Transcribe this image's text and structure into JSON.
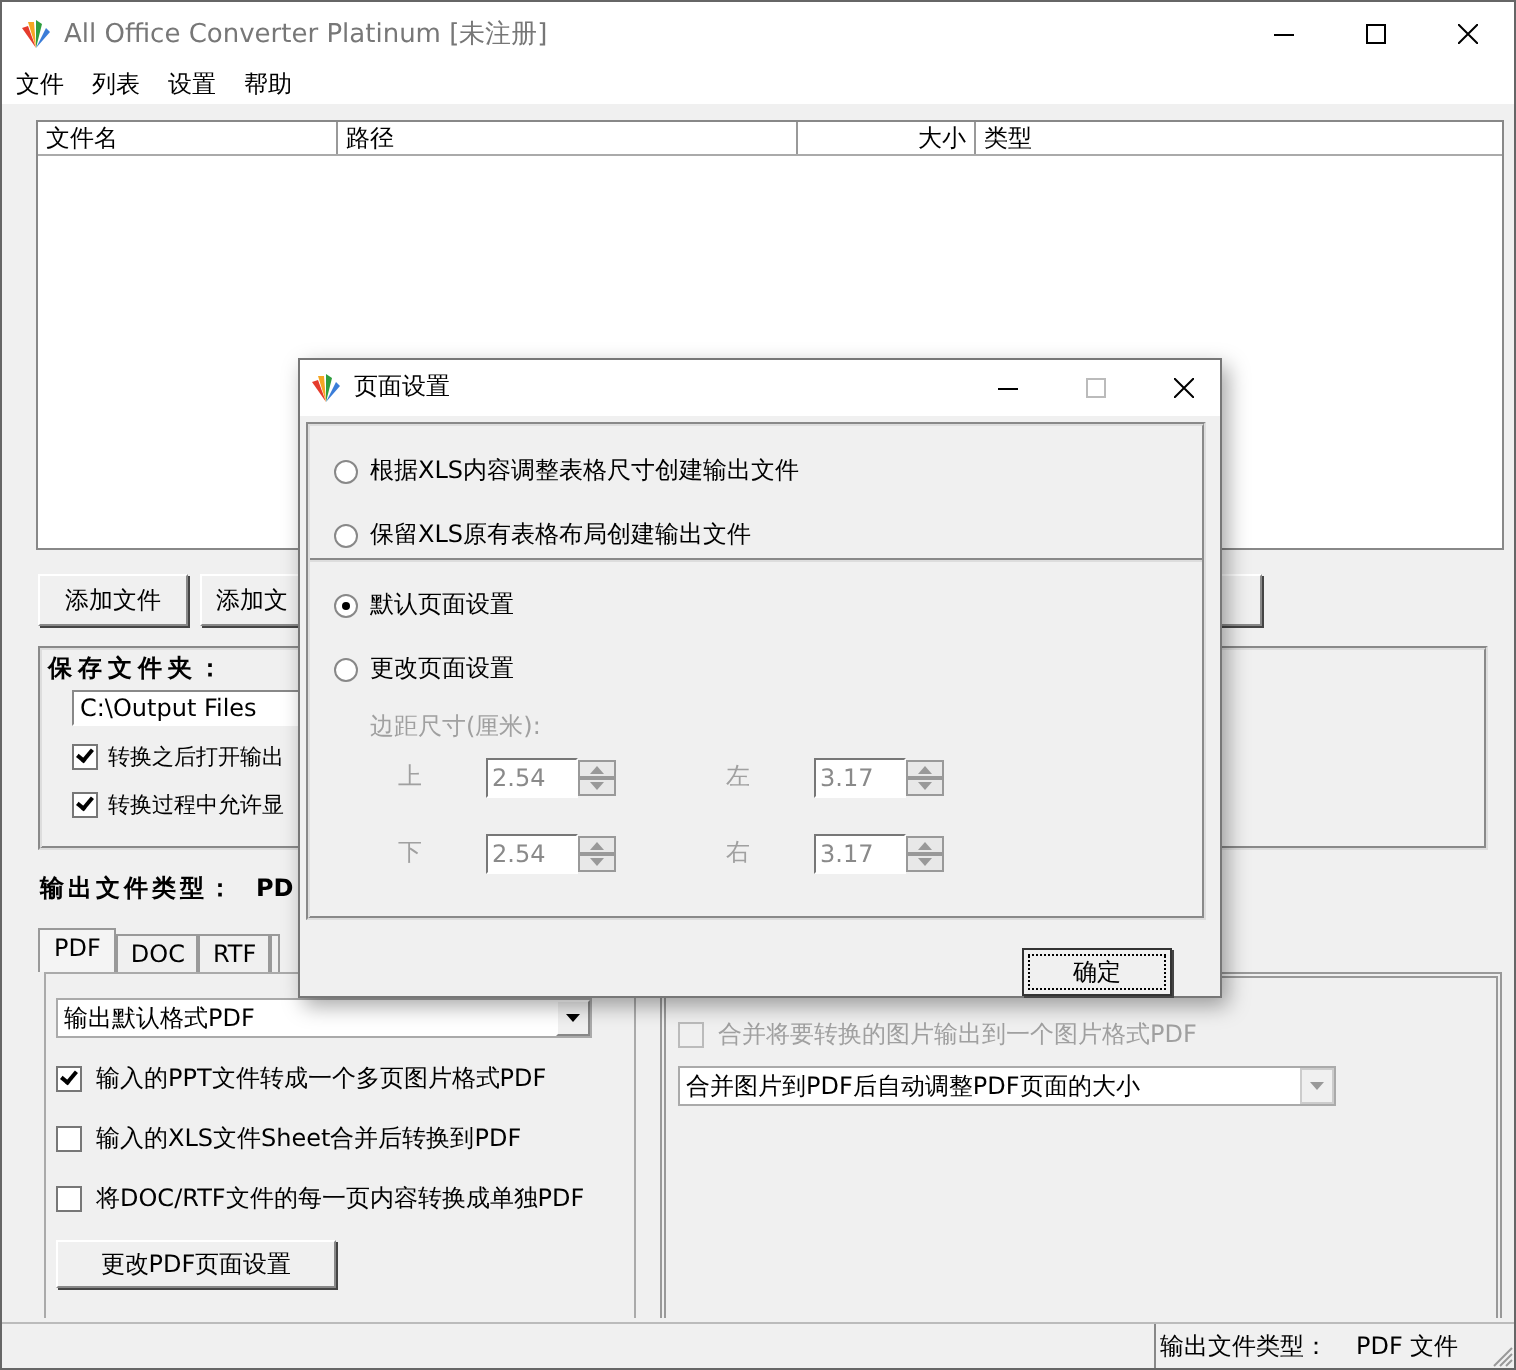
{
  "window": {
    "title": "All Office Converter Platinum [未注册]"
  },
  "menu": [
    "文件",
    "列表",
    "设置",
    "帮助"
  ],
  "file_list": {
    "columns": [
      "文件名",
      "路径",
      "大小",
      "类型"
    ]
  },
  "buttons": [
    "添加文件",
    "添加文"
  ],
  "save_folder": {
    "label": "保存文件夹：",
    "path": "C:\\Output Files",
    "options": [
      {
        "label": "转换之后打开输出",
        "checked": true
      },
      {
        "label": "转换过程中允许显",
        "checked": true
      }
    ]
  },
  "output_type": {
    "label": "输出文件类型：",
    "value": "PD"
  },
  "tabs": [
    {
      "label": "PDF",
      "selected": true
    },
    {
      "label": "DOC",
      "selected": false
    },
    {
      "label": "RTF",
      "selected": false
    }
  ],
  "pdf_panel": {
    "format": "输出默认格式PDF",
    "options": [
      {
        "label": "输入的PPT文件转成一个多页图片格式PDF",
        "checked": true
      },
      {
        "label": "输入的XLS文件Sheet合并后转换到PDF",
        "checked": false
      },
      {
        "label": "将DOC/RTF文件的每一页内容转换成单独PDF",
        "checked": false
      }
    ],
    "button": "更改PDF页面设置"
  },
  "image_panel": {
    "merge_option": {
      "label": "合并将要转换的图片输出到一个图片格式PDF",
      "checked": false,
      "disabled": true
    },
    "resize": "合并图片到PDF后自动调整PDF页面的大小"
  },
  "status_bar": {
    "label": "输出文件类型：",
    "value": "PDF 文件"
  },
  "dialog": {
    "title": "页面设置",
    "xls_options": [
      {
        "label": "根据XLS内容调整表格尺寸创建输出文件",
        "selected": false
      },
      {
        "label": "保留XLS原有表格布局创建输出文件",
        "selected": false
      }
    ],
    "page_options": [
      {
        "label": "默认页面设置",
        "selected": true
      },
      {
        "label": "更改页面设置",
        "selected": false
      }
    ],
    "margins": {
      "label": "边距尺寸(厘米):",
      "disabled": true,
      "fields": [
        {
          "label": "上",
          "value": "2.54"
        },
        {
          "label": "左",
          "value": "3.17"
        },
        {
          "label": "下",
          "value": "2.54"
        },
        {
          "label": "右",
          "value": "3.17"
        }
      ]
    },
    "ok": "确定"
  }
}
